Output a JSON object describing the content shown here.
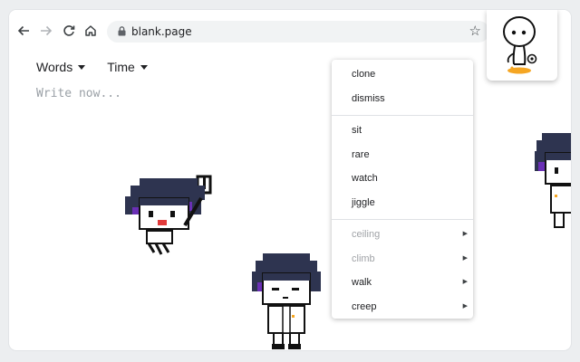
{
  "browser": {
    "url": "blank.page",
    "back_icon": "arrow-left-icon",
    "forward_icon": "arrow-right-icon",
    "reload_icon": "reload-icon",
    "home_icon": "home-icon",
    "lock_icon": "lock-icon",
    "bookmark_icon": "star-icon",
    "menu_icon": "kebab-menu-icon"
  },
  "app": {
    "menus": [
      {
        "label": "Words"
      },
      {
        "label": "Time"
      }
    ],
    "editor_placeholder": "Write now..."
  },
  "context_menu": {
    "groups": [
      [
        {
          "label": "clone"
        },
        {
          "label": "dismiss"
        }
      ],
      [
        {
          "label": "sit"
        },
        {
          "label": "rare"
        },
        {
          "label": "watch"
        },
        {
          "label": "jiggle"
        }
      ],
      [
        {
          "label": "ceiling",
          "disabled": true,
          "submenu": true
        },
        {
          "label": "climb",
          "disabled": true,
          "submenu": true
        },
        {
          "label": "walk",
          "disabled": false,
          "submenu": true
        },
        {
          "label": "creep",
          "disabled": false,
          "submenu": true
        }
      ]
    ]
  },
  "colors": {
    "hair": "#2e3450",
    "hair_accent": "#6a2fb5",
    "accent_orange": "#f5a623"
  }
}
